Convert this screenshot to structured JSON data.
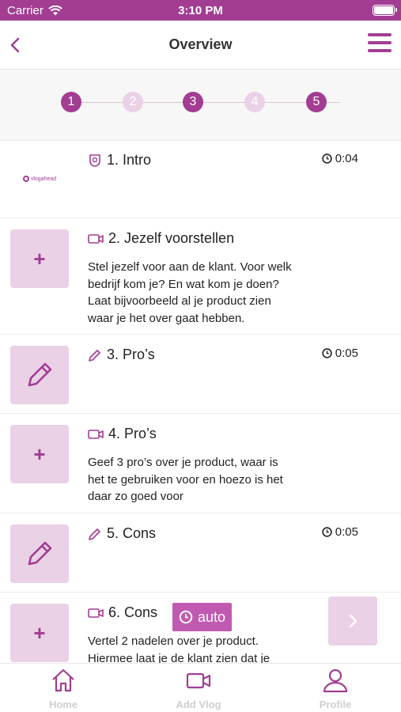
{
  "status_bar": {
    "carrier": "Carrier",
    "time": "3:10 PM"
  },
  "nav": {
    "title": "Overview"
  },
  "stepper": {
    "steps": [
      "1",
      "2",
      "3",
      "4",
      "5"
    ],
    "completed": [
      true,
      false,
      true,
      false,
      true
    ]
  },
  "items": [
    {
      "title": "1. Intro",
      "duration": "0:04",
      "logo_text": "vlogahead"
    },
    {
      "title": "2. Jezelf voorstellen",
      "description": [
        "Stel jezelf voor aan de klant. Voor welk",
        "bedrijf kom je? En wat kom je doen?",
        "Laat bijvoorbeeld al je product zien",
        "waar je het over gaat hebben."
      ],
      "thumb_symbol": "+"
    },
    {
      "title": "3. Pro’s",
      "duration": "0:05"
    },
    {
      "title": "4. Pro’s",
      "description": [
        "Geef 3 pro’s over je product, waar is",
        "het te gebruiken voor en hoezo is het",
        "daar zo goed voor"
      ],
      "thumb_symbol": "+"
    },
    {
      "title": "5. Cons",
      "duration": "0:05"
    },
    {
      "title": "6. Cons",
      "auto_label": "auto",
      "description": [
        "Vertel 2 nadelen over je product.",
        "Hiermee laat je de klant zien dat je"
      ],
      "thumb_symbol": "+"
    }
  ],
  "tabs": [
    {
      "label": "Home",
      "icon": "home-icon"
    },
    {
      "label": "Add Vlog",
      "icon": "video-camera-icon"
    },
    {
      "label": "Profile",
      "icon": "user-icon"
    }
  ],
  "colors": {
    "brand": "#a23d92",
    "thumb_bg": "#ead1e6",
    "inactive_tab": "#cfcfcf",
    "auto_badge": "#c05ab0"
  }
}
